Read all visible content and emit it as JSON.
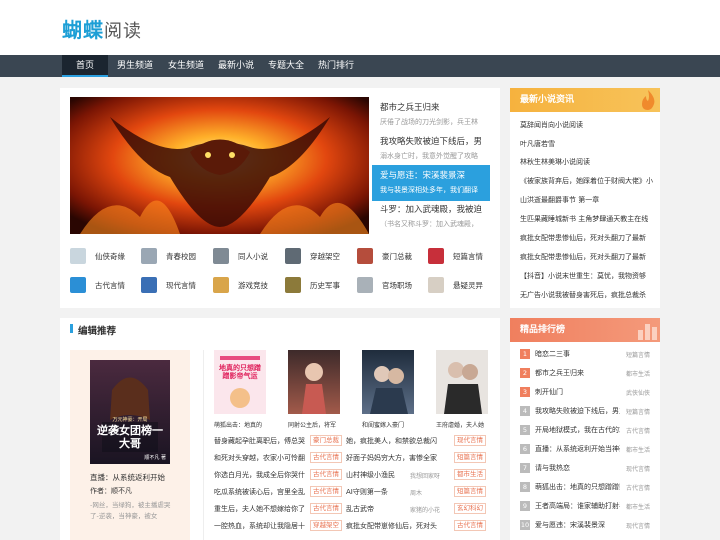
{
  "logo": {
    "part1": "蝴蝶",
    "part2": "阅读"
  },
  "nav": [
    "首页",
    "男生频道",
    "女生频道",
    "最新小说",
    "专题大全",
    "热门排行"
  ],
  "hot": [
    {
      "title": "都市之兵王归来",
      "desc": "厌倦了战场的刀光剑影，兵王林"
    },
    {
      "title": "我攻略失败被迫下线后，男",
      "desc": "溺水身亡时，我意外觉醒了攻略"
    },
    {
      "title": "爱与愿违：宋溪裴景深",
      "desc": "我与裴景深相处多年，我们翻译"
    },
    {
      "title": "斗罗：加入武魂殿，我被迫",
      "desc": "（书名又称斗罗：加入武魂殿，"
    }
  ],
  "categories": [
    "仙侠奇缘",
    "青春校园",
    "同人小说",
    "穿越架空",
    "豪门总裁",
    "短篇言情",
    "古代言情",
    "现代言情",
    "游戏竞技",
    "历史军事",
    "官场职场",
    "悬疑灵异"
  ],
  "news": {
    "title": "最新小说资讯",
    "items": [
      "莫辞闻肖向小说阅读",
      "叶凡唐若雪",
      "林秋生林美琳小说阅读",
      "《被家族背弃后，她踩着位于财阀大佬》小",
      "山洪逝最翻爵事节 第一章",
      "生匹果藏睡城新书 主角梦肆通天教主在线",
      "疯批女配带患惨仙后，死对头翻刀了最新",
      "疯批女配带患惨仙后，死对头翻刀了最新",
      "【抖音】小说末世重生：莫忧，我物资够",
      "无广告小说我被替身害死后，疯批总裁杀"
    ]
  },
  "rank": {
    "title": "精品排行榜",
    "items": [
      {
        "n": "1",
        "title": "暗恋二三事",
        "cat": "短篇言情"
      },
      {
        "n": "2",
        "title": "都市之兵王归来",
        "cat": "都市生活"
      },
      {
        "n": "3",
        "title": "刺开仙门",
        "cat": "武侠仙侠"
      },
      {
        "n": "4",
        "title": "我攻略失败被迫下线后，男主",
        "cat": "短篇言情"
      },
      {
        "n": "5",
        "title": "开局地狱模式，我在古代的求",
        "cat": "古代言情"
      },
      {
        "n": "6",
        "title": "直播：从系统返利开始当神豪",
        "cat": "都市生活"
      },
      {
        "n": "7",
        "title": "请与我热恋",
        "cat": "现代言情"
      },
      {
        "n": "8",
        "title": "萌狐出击：地真的只想蹭蹭影",
        "cat": "古代言情"
      },
      {
        "n": "9",
        "title": "王者高端局：谁家辅助打射手",
        "cat": "都市生活"
      },
      {
        "n": "10",
        "title": "爱与愿违：宋溪裴景深",
        "cat": "现代言情"
      }
    ]
  },
  "editor": {
    "title": "编辑推荐",
    "featured": {
      "cover_text": "逆袭女团榜一大哥",
      "cover_sub": "万元神豪：开局",
      "cover_author": "顺不凡 著",
      "title": "直播：从系统返利开始",
      "author": "作者：顺不凡",
      "desc": "-网丝，当绿狗，被主播虐哭了-逆袭，当神豪，被女"
    },
    "books": [
      {
        "title": "萌狐出击：地真的",
        "cover_text": "地真的只想蹭蹭影帝气运"
      },
      {
        "title": "同射公主后，将军",
        "cover_text": ""
      },
      {
        "title": "和闺蜜嫁入豪门",
        "cover_text": ""
      },
      {
        "title": "王府虐婚，夫人她",
        "cover_text": ""
      }
    ],
    "list_left": [
      {
        "title": "替身藏起孕肚离职后，傅总哭",
        "tag": "豪门总裁"
      },
      {
        "title": "和死对头穿越，农家小可怜翻",
        "tag": "古代言情"
      },
      {
        "title": "你选白月光，我成全后你哭什",
        "tag": "古代言情"
      },
      {
        "title": "吃瓜系统被读心后，宫里全乱",
        "tag": "古代言情"
      },
      {
        "title": "重生后，夫人她不想嫁给你了",
        "tag": "古代言情"
      },
      {
        "title": "一腔热血，系统却让我隐居十",
        "tag": "穿越架空"
      }
    ],
    "list_right": [
      {
        "title": "她，疯批美人，和禁欲总裁闪",
        "author": "",
        "tag": "现代言情"
      },
      {
        "title": "好面子妈妈穷大方，害惨全家",
        "author": "",
        "tag": "短篇言情"
      },
      {
        "title": "山村神级小渔民",
        "author": "我想回家呀",
        "tag": "都市生活"
      },
      {
        "title": "AI守则第一条",
        "author": "周木",
        "tag": "短篇言情"
      },
      {
        "title": "乱古武帝",
        "author": "家猪的小花",
        "tag": "玄幻科幻"
      },
      {
        "title": "疯批女配带崽修仙后，死对头",
        "author": "",
        "tag": "古代言情"
      }
    ]
  }
}
